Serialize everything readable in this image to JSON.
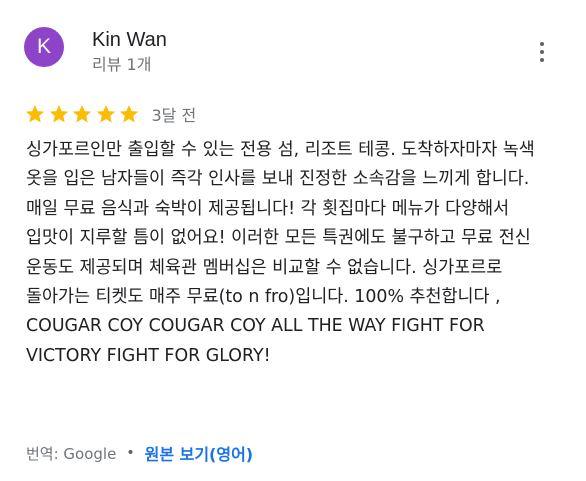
{
  "reviewer": {
    "avatar_letter": "K",
    "avatar_color": "#8e44c9",
    "name": "Kin Wan",
    "meta": "리뷰 1개"
  },
  "rating": {
    "stars": 5,
    "star_color": "#fbbc04",
    "date": "3달 전"
  },
  "review": {
    "text": "싱가포르인만 출입할 수 있는 전용 섬, 리조트 테콩. 도착하자마자 녹색 옷을 입은 남자들이 즉각 인사를 보내 진정한 소속감을 느끼게 합니다. 매일 무료 음식과 숙박이 제공됩니다! 각 횟집마다 메뉴가 다양해서 입맛이 지루할 틈이 없어요! 이러한 모든 특권에도 불구하고 무료 전신 운동도 제공되며 체육관 멤버십은 비교할 수 없습니다. 싱가포르로 돌아가는 티켓도 매주 무료(to n fro)입니다. 100% 추천합니다 , COUGAR COY COUGAR COY ALL THE WAY FIGHT FOR VICTORY FIGHT FOR GLORY!"
  },
  "translation": {
    "label": "번역: Google",
    "separator": "•",
    "original_link": "원본 보기(영어)",
    "link_color": "#1a73e8"
  },
  "icons": {
    "more": "more-vert-icon",
    "star": "star-icon"
  }
}
